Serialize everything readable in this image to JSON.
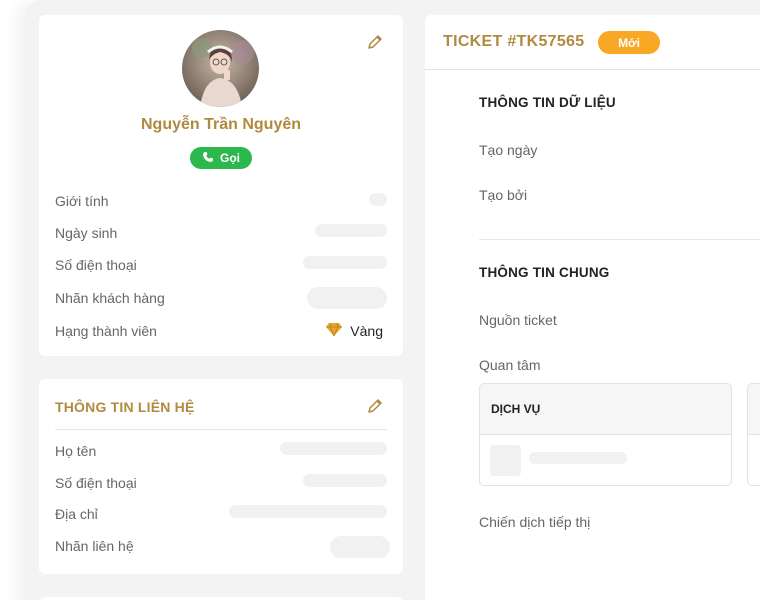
{
  "profile": {
    "name": "Nguyễn Trần Nguyên",
    "call_label": "Gọi",
    "fields": {
      "gender": "Giới tính",
      "birthday": "Ngày sinh",
      "phone": "Số điện thoại",
      "customer_tag": "Nhãn khách hàng",
      "member_tier": "Hạng thành viên"
    },
    "member_tier_value": "Vàng"
  },
  "contact": {
    "title": "THÔNG TIN LIÊN HỆ",
    "fields": {
      "full_name": "Họ tên",
      "phone": "Số điện thoại",
      "address": "Địa chỉ",
      "contact_tag": "Nhãn liên hệ"
    }
  },
  "ticket": {
    "title": "TICKET #TK57565",
    "status": "Mới",
    "data_section": {
      "title": "THÔNG TIN DỮ LIỆU",
      "created_date": "Tạo ngày",
      "created_by": "Tạo bởi"
    },
    "general_section": {
      "title": "THÔNG TIN CHUNG",
      "source": "Nguồn ticket",
      "interest": "Quan tâm",
      "interest_table_header": "DỊCH VỤ",
      "campaign": "Chiến dịch tiếp thị"
    }
  },
  "colors": {
    "accent_gold": "#b08a3e",
    "call_green": "#2db84d",
    "status_orange": "#f9a825"
  },
  "icons": [
    "edit-icon",
    "phone-icon",
    "diamond-icon"
  ]
}
